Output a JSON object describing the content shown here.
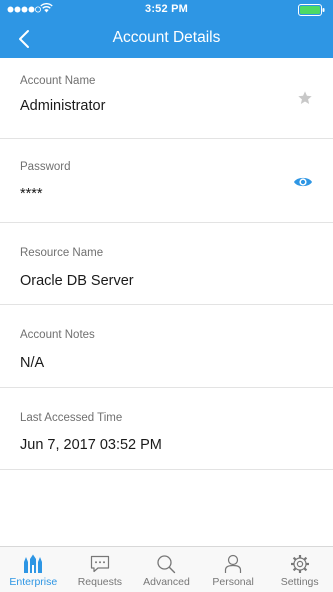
{
  "status_bar": {
    "time": "3:52 PM"
  },
  "header": {
    "title": "Account Details"
  },
  "fields": [
    {
      "label": "Account Name",
      "value": "Administrator"
    },
    {
      "label": "Password",
      "value": "****"
    },
    {
      "label": "Resource Name",
      "value": "Oracle DB  Server"
    },
    {
      "label": "Account Notes",
      "value": "N/A"
    },
    {
      "label": "Last Accessed Time",
      "value": "Jun 7, 2017 03:52 PM"
    }
  ],
  "tabs": [
    {
      "label": "Enterprise",
      "icon": "enterprise-icon",
      "active": true
    },
    {
      "label": "Requests",
      "icon": "chat-icon",
      "active": false
    },
    {
      "label": "Advanced",
      "icon": "search-icon",
      "active": false
    },
    {
      "label": "Personal",
      "icon": "person-icon",
      "active": false
    },
    {
      "label": "Settings",
      "icon": "gear-icon",
      "active": false
    }
  ],
  "colors": {
    "accent": "#2e96e4",
    "star": "#c8c8c8",
    "divider": "#e3e3e3"
  }
}
